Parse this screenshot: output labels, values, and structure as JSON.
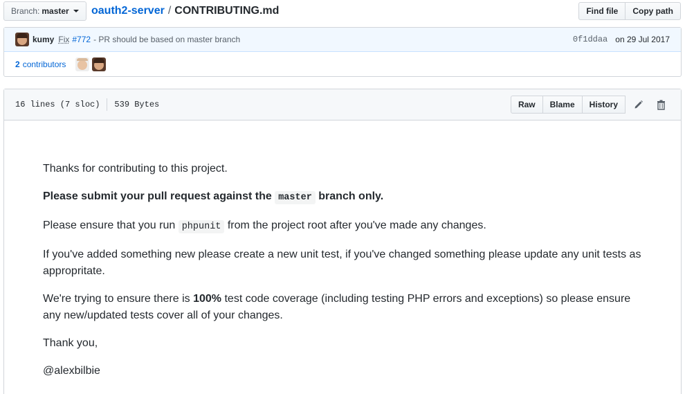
{
  "toolbar": {
    "branch_prefix": "Branch:",
    "branch_name": "master",
    "repo": "oauth2-server",
    "separator": "/",
    "file_name": "CONTRIBUTING.md",
    "find_file": "Find file",
    "copy_path": "Copy path"
  },
  "commit": {
    "author": "kumy",
    "fix_word": "Fix",
    "issue": "#772",
    "message": "- PR should be based on master branch",
    "sha": "0f1ddaa",
    "date": "on 29 Jul 2017",
    "contributors_count": "2",
    "contributors_label": "contributors"
  },
  "file": {
    "lines": "16 lines (7 sloc)",
    "size": "539 Bytes",
    "raw": "Raw",
    "blame": "Blame",
    "history": "History",
    "icons": [
      "pencil-icon",
      "trash-icon"
    ]
  },
  "content": {
    "p1": "Thanks for contributing to this project.",
    "p2_a": "Please submit your pull request against the",
    "p2_code": "master",
    "p2_b": "branch only.",
    "p3_a": "Please ensure that you run",
    "p3_code": "phpunit",
    "p3_b": "from the project root after you've made any changes.",
    "p4": "If you've added something new please create a new unit test, if you've changed something please update any unit tests as appropritate.",
    "p5_a": "We're trying to ensure there is",
    "p5_bold": "100%",
    "p5_b": "test code coverage (including testing PHP errors and exceptions) so please ensure any new/updated tests cover all of your changes.",
    "p6": "Thank you,",
    "p7": "@alexbilbie"
  }
}
